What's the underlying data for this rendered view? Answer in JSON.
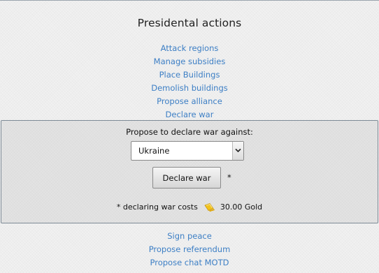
{
  "page": {
    "title": "Presidental actions"
  },
  "actions_top": [
    {
      "label": "Attack regions"
    },
    {
      "label": "Manage subsidies"
    },
    {
      "label": "Place Buildings"
    },
    {
      "label": "Demolish buildings"
    },
    {
      "label": "Propose alliance"
    },
    {
      "label": "Declare war"
    }
  ],
  "war_panel": {
    "prompt": "Propose to declare war against:",
    "selected_country": "Ukraine",
    "declare_button_label": "Declare war",
    "asterisk": "*",
    "cost_note": "* declaring war costs",
    "cost_amount": "30.00 Gold",
    "cost_icon": "gold-icon"
  },
  "actions_bottom": [
    {
      "label": "Sign peace"
    },
    {
      "label": "Propose referendum"
    },
    {
      "label": "Propose chat MOTD"
    }
  ],
  "colors": {
    "link": "#3d7fc5",
    "panel_border": "#7d8a96",
    "gold": "#f2c21a"
  }
}
